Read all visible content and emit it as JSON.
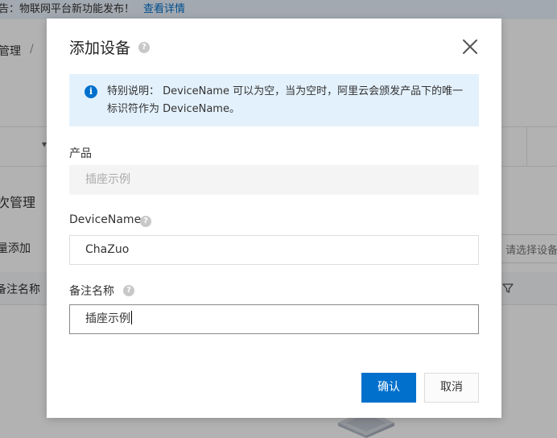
{
  "background": {
    "notice": {
      "text": "告：物联网平台新功能发布！",
      "link": "查看详情"
    },
    "breadcrumb": {
      "current": "管理",
      "separator": "/"
    },
    "section_title": "次管理",
    "batch_add": "量添加",
    "select_placeholder": "请选择设备",
    "table_header": {
      "remark_column": "备注名称"
    }
  },
  "dialog": {
    "title": "添加设备",
    "help_glyph": "?",
    "info": {
      "icon_glyph": "i",
      "text": "特别说明： DeviceName 可以为空，当为空时，阿里云会颁发产品下的唯一标识符作为 DeviceName。"
    },
    "fields": {
      "product": {
        "label": "产品",
        "value": "插座示例"
      },
      "device_name": {
        "label": "DeviceName",
        "value": "ChaZuo"
      },
      "remark": {
        "label": "备注名称",
        "value": "插座示例"
      }
    },
    "buttons": {
      "confirm": "确认",
      "cancel": "取消"
    }
  },
  "colors": {
    "primary": "#0070cc",
    "info_bg": "#e3f1fc",
    "mask": "rgba(0,0,0,0.3)"
  }
}
